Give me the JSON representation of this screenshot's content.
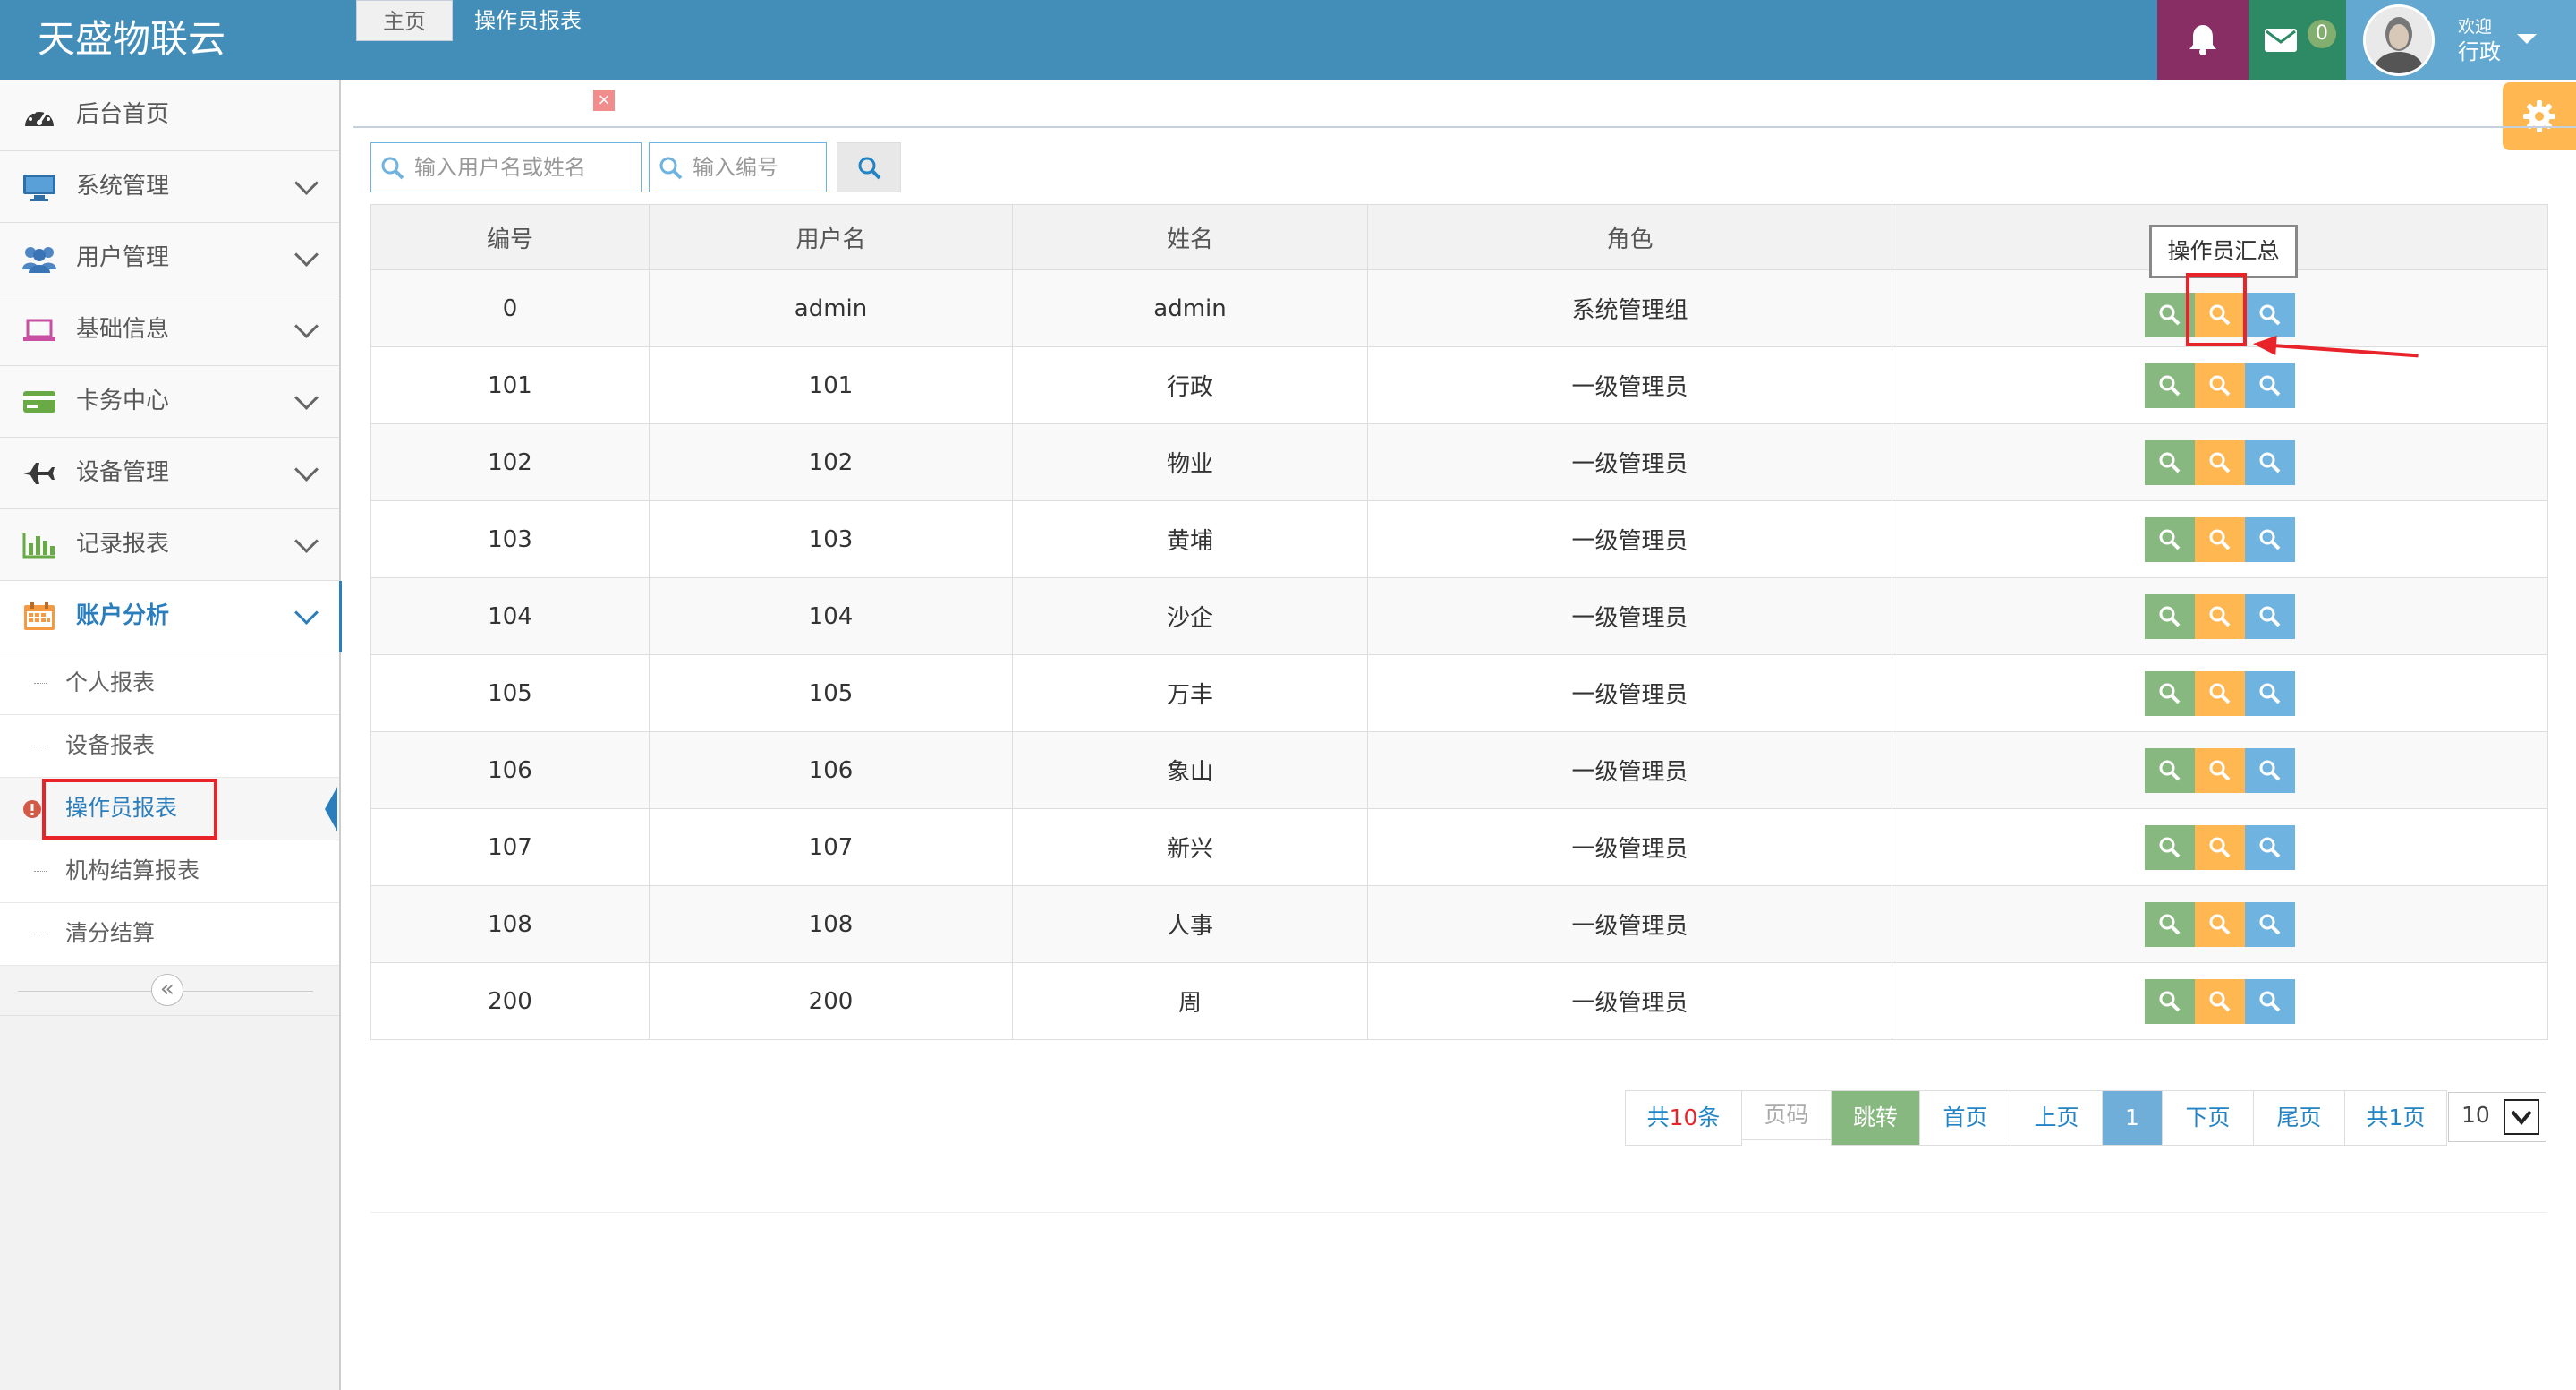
{
  "app": {
    "title": "天盛物联云"
  },
  "header": {
    "mail_count": "0",
    "welcome": "欢迎",
    "username": "行政",
    "colors": {
      "bar": "#438eb9",
      "bell": "#892e65",
      "mail": "#2e8965",
      "user": "#62a8d1"
    }
  },
  "sidebar": {
    "items": [
      {
        "label": "后台首页",
        "icon": "dashboard-icon"
      },
      {
        "label": "系统管理",
        "icon": "monitor-icon"
      },
      {
        "label": "用户管理",
        "icon": "users-icon"
      },
      {
        "label": "基础信息",
        "icon": "laptop-icon"
      },
      {
        "label": "卡务中心",
        "icon": "credit-card-icon"
      },
      {
        "label": "设备管理",
        "icon": "plane-icon"
      },
      {
        "label": "记录报表",
        "icon": "bar-chart-icon"
      },
      {
        "label": "账户分析",
        "icon": "calendar-icon"
      }
    ],
    "subitems": [
      "个人报表",
      "设备报表",
      "操作员报表",
      "机构结算报表",
      "清分结算"
    ],
    "collapse_glyph": "«"
  },
  "tabs": [
    {
      "label": "主页"
    },
    {
      "label": "操作员报表"
    }
  ],
  "search": {
    "name_placeholder": "输入用户名或姓名",
    "code_placeholder": "输入编号"
  },
  "table": {
    "headers": [
      "编号",
      "用户名",
      "姓名",
      "角色",
      ""
    ],
    "rows": [
      {
        "id": "0",
        "username": "admin",
        "name": "admin",
        "role": "系统管理组"
      },
      {
        "id": "101",
        "username": "101",
        "name": "行政",
        "role": "一级管理员"
      },
      {
        "id": "102",
        "username": "102",
        "name": "物业",
        "role": "一级管理员"
      },
      {
        "id": "103",
        "username": "103",
        "name": "黄埔",
        "role": "一级管理员"
      },
      {
        "id": "104",
        "username": "104",
        "name": "沙企",
        "role": "一级管理员"
      },
      {
        "id": "105",
        "username": "105",
        "name": "万丰",
        "role": "一级管理员"
      },
      {
        "id": "106",
        "username": "106",
        "name": "象山",
        "role": "一级管理员"
      },
      {
        "id": "107",
        "username": "107",
        "name": "新兴",
        "role": "一级管理员"
      },
      {
        "id": "108",
        "username": "108",
        "name": "人事",
        "role": "一级管理员"
      },
      {
        "id": "200",
        "username": "200",
        "name": "周",
        "role": "一级管理员"
      }
    ],
    "action_colors": [
      "#87b87f",
      "#ffb752",
      "#6fb3e0"
    ]
  },
  "tooltip": {
    "text": "操作员汇总"
  },
  "pager": {
    "total_prefix": "共",
    "total_count": "10",
    "total_suffix": "条",
    "page_input": "页码",
    "jump": "跳转",
    "first": "首页",
    "prev": "上页",
    "current": "1",
    "next": "下页",
    "last": "尾页",
    "pages": "共1页",
    "page_size": "10"
  }
}
